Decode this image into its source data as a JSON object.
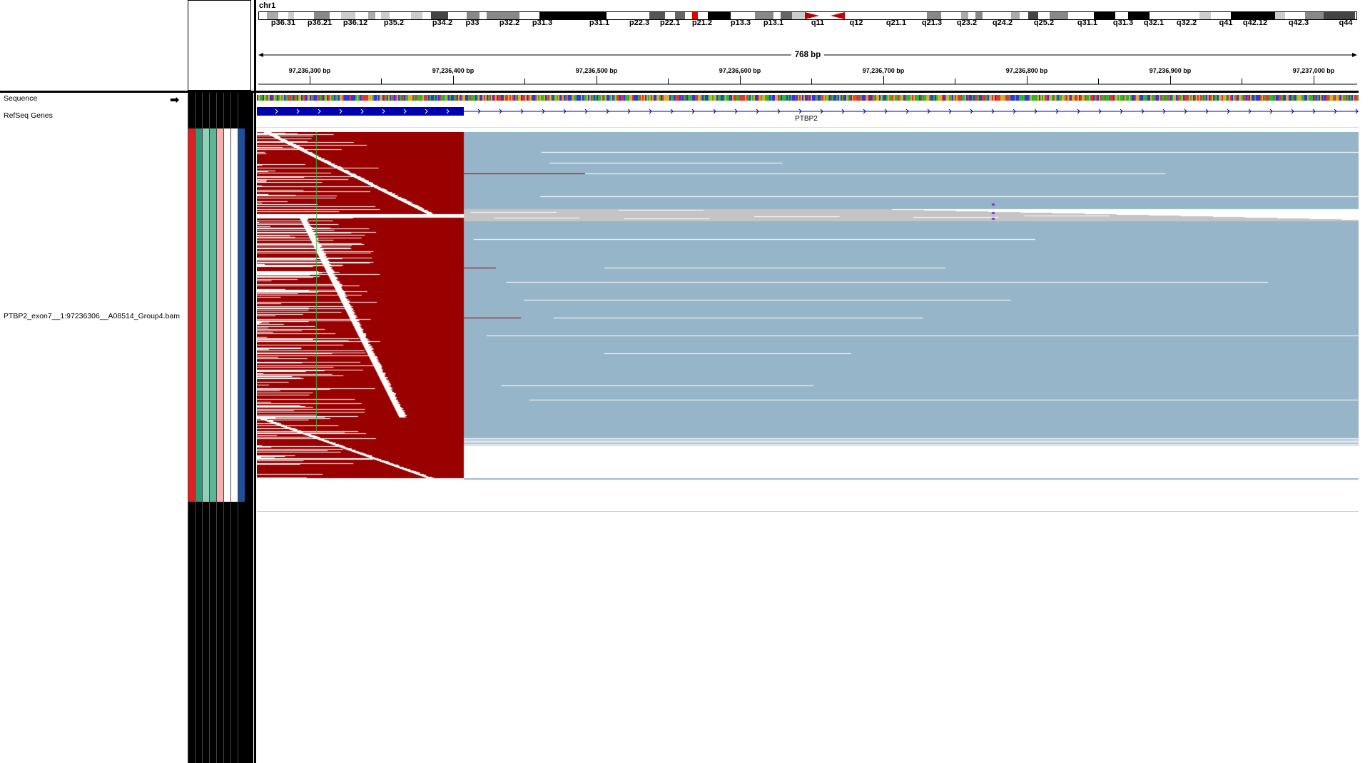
{
  "chromosome": "chr1",
  "ideogram": {
    "bands": [
      "p36.31",
      "p36.21",
      "p36.12",
      "p35.2",
      "p34.2",
      "p33",
      "p32.2",
      "p31.3",
      "p31.1",
      "p22.3",
      "p22.1",
      "p21.2",
      "p13.3",
      "p13.1",
      "q11",
      "q12",
      "q21.1",
      "q21.3",
      "q23.2",
      "q24.2",
      "q25.2",
      "q31.1",
      "q31.3",
      "q32.1",
      "q32.2",
      "q41",
      "q42.12",
      "q42.3",
      "q44"
    ]
  },
  "ruler": {
    "span": "768 bp",
    "ticks": [
      "97,236,300 bp",
      "97,236,400 bp",
      "97,236,500 bp",
      "97,236,600 bp",
      "97,236,700 bp",
      "97,236,800 bp",
      "97,236,900 bp",
      "97,237,000 bp"
    ]
  },
  "tracks": {
    "sequence": "Sequence",
    "genes": "RefSeq Genes",
    "gene_name": "PTBP2",
    "bam": "PTBP2_exon7__1:97236306__A08514_Group4.bam"
  },
  "colors": {
    "clipped_read": "#990000",
    "aligned_read": "#97b5c8",
    "secondary_read": "#c4c4c4",
    "gene_exon": "#0000b3",
    "attr_red": "#e02020",
    "attr_teal": "#2e9a7a",
    "attr_mint": "#8fd0b8",
    "attr_pink": "#f6b0b0",
    "attr_blue": "#1e4f9e"
  }
}
